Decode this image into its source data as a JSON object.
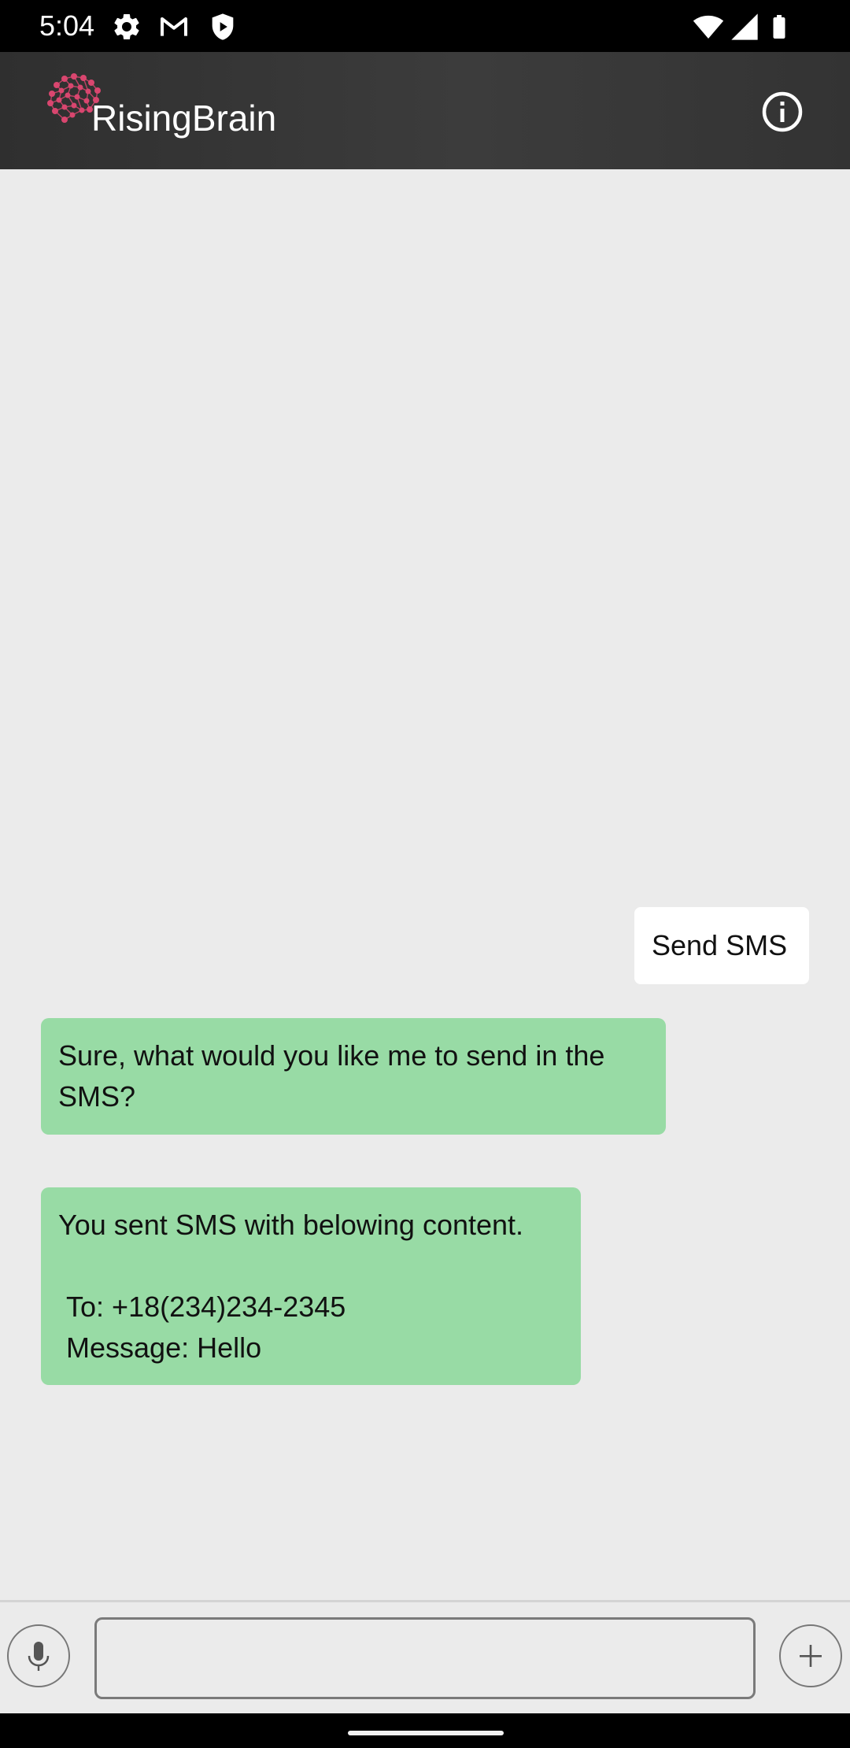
{
  "status_bar": {
    "time": "5:04",
    "left_icons": [
      "gear-icon",
      "gmail-icon",
      "shield-icon"
    ],
    "right_icons": [
      "wifi-icon",
      "cell-signal-icon",
      "battery-icon"
    ]
  },
  "app_bar": {
    "title": "RisingBrain",
    "logo_icon": "brain-logo-icon",
    "info_icon": "info-icon"
  },
  "chat": {
    "messages": [
      {
        "sender": "user",
        "text": "Send SMS"
      },
      {
        "sender": "bot",
        "text": "Sure, what would you like me to send in the SMS?"
      },
      {
        "sender": "bot",
        "text": "You sent SMS with belowing content.\n\n To: +18(234)234-2345\n Message: Hello"
      }
    ]
  },
  "input_bar": {
    "value": "",
    "placeholder": "",
    "mic_icon": "microphone-icon",
    "add_icon": "plus-icon"
  },
  "colors": {
    "status_bar": "#000000",
    "app_bar": "#363636",
    "chat_background": "#ebebeb",
    "bot_bubble": "#98dba5",
    "user_bubble": "#ffffff",
    "logo_accent": "#d9466f"
  }
}
